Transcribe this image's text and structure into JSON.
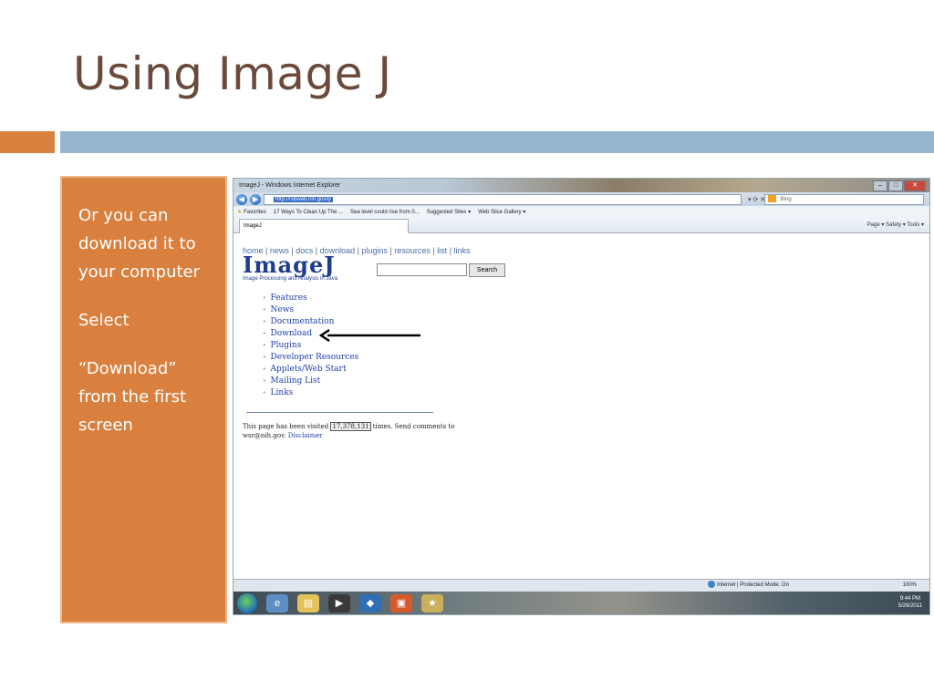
{
  "slide": {
    "title": "Using Image J",
    "panel_lines": [
      "Or you can download it to your computer",
      "Select",
      "“Download” from the first screen"
    ],
    "colors": {
      "title": "#6b4a3b",
      "accent_orange": "#d9803f",
      "accent_blue": "#96b5d0"
    }
  },
  "browser": {
    "window_title": "ImageJ - Windows Internet Explorer",
    "url": "http://rsbweb.nih.gov/ij/",
    "search_placeholder": "Bing",
    "favorites_label": "Favorites",
    "favorites": [
      "17 Ways To Clean Up The ...",
      "Sea level could rise from 0...",
      "Suggested Sites ▾",
      "Web Slice Gallery ▾"
    ],
    "tab_label": "ImageJ",
    "command_bar": "Page ▾  Safety ▾  Tools ▾",
    "status_zone": "Internet | Protected Mode: On",
    "zoom": "100%",
    "clock_time": "9:44 PM",
    "clock_date": "5/26/2011"
  },
  "page": {
    "topnav": [
      "home",
      "news",
      "docs",
      "download",
      "plugins",
      "resources",
      "list",
      "links"
    ],
    "logo": "ImageJ",
    "tagline": "Image Processing and Analysis in Java",
    "search_button": "Search",
    "links": [
      "Features",
      "News",
      "Documentation",
      "Download",
      "Plugins",
      "Developer Resources",
      "Applets/Web Start",
      "Mailing List",
      "Links"
    ],
    "footer_pre": "This page has been visited",
    "footer_counter": "17,378,131",
    "footer_post": "times. Send comments to wsr@nih.gov.",
    "footer_link": "Disclaimer"
  }
}
